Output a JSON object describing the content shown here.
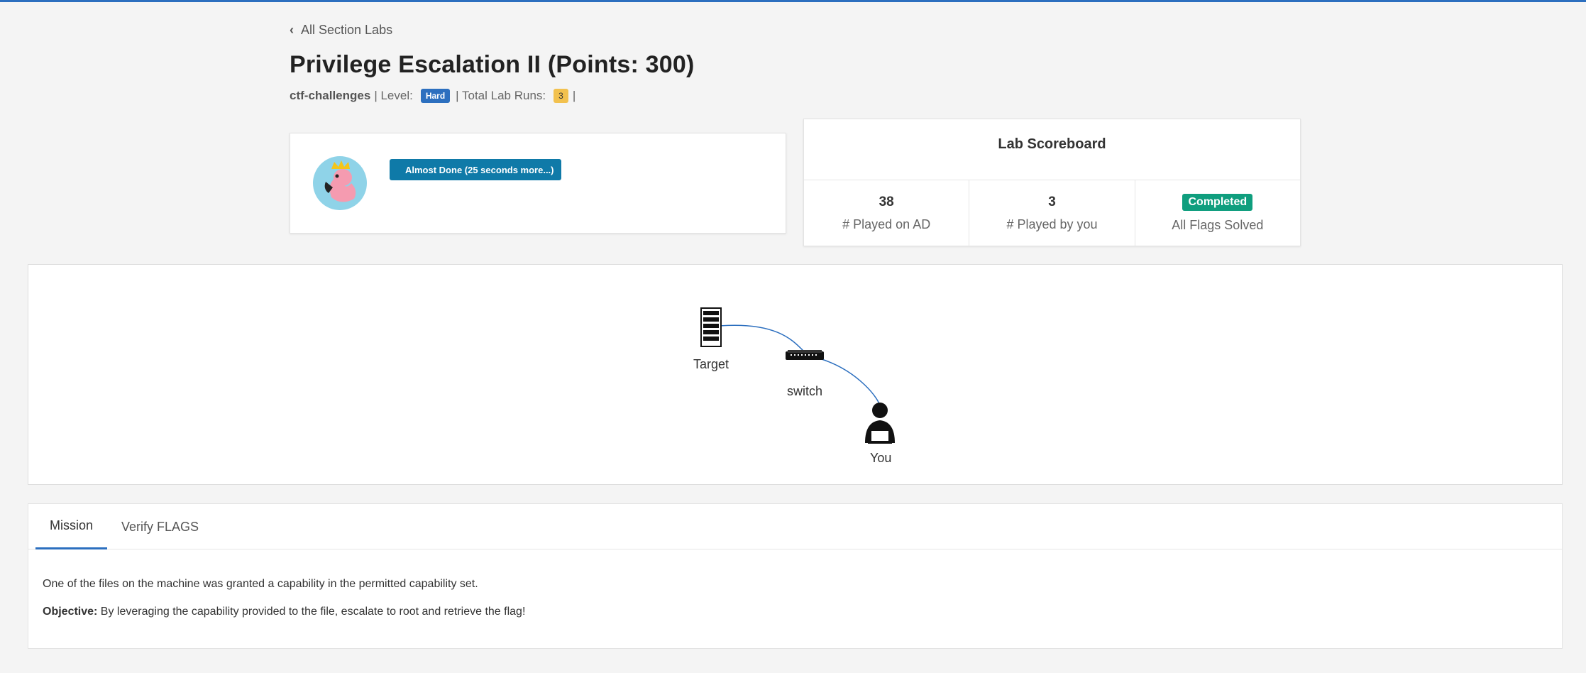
{
  "nav": {
    "back_label": "All Section Labs"
  },
  "lab": {
    "title": "Privilege Escalation II (Points: 300)",
    "category": "ctf-challenges",
    "level_label": "| Level:",
    "level": "Hard",
    "runs_label": "| Total Lab Runs:",
    "runs": "3",
    "trailing_sep": "|"
  },
  "status": {
    "button_label": "Almost Done (25 seconds more...)"
  },
  "scoreboard": {
    "title": "Lab Scoreboard",
    "stats": [
      {
        "value": "38",
        "label": "# Played on AD"
      },
      {
        "value": "3",
        "label": "# Played by you"
      },
      {
        "value": "Completed",
        "label": "All Flags Solved"
      }
    ]
  },
  "network": {
    "nodes": [
      {
        "label": "Target",
        "icon": "server-icon"
      },
      {
        "label": "switch",
        "icon": "switch-icon"
      },
      {
        "label": "You",
        "icon": "user-laptop-icon"
      }
    ],
    "link_color": "#2c6fbf"
  },
  "tabs": [
    {
      "label": "Mission",
      "active": true
    },
    {
      "label": "Verify FLAGS",
      "active": false
    }
  ],
  "mission": {
    "line1": "One of the files on the machine was granted a capability in the permitted capability set.",
    "objective_label": "Objective:",
    "objective_text": " By leveraging the capability provided to the file, escalate to root and retrieve the flag!"
  },
  "colors": {
    "accent": "#2c6fbf",
    "status_button": "#0f7aa8",
    "completed": "#0f9e7e",
    "runs_badge": "#f2c14e"
  }
}
